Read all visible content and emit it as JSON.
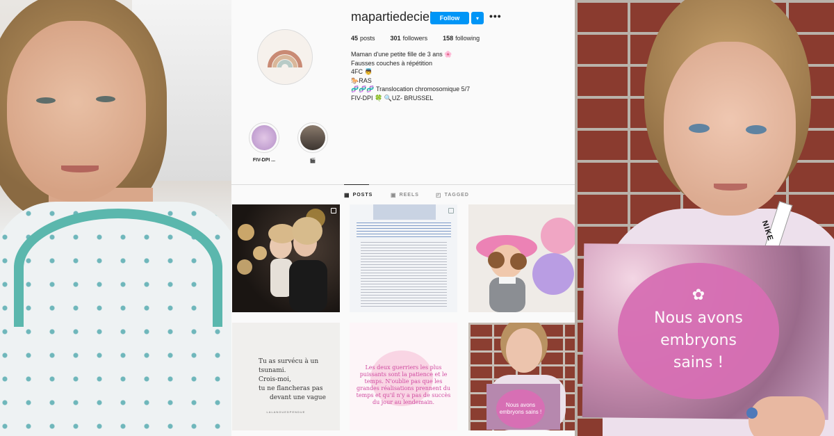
{
  "profile": {
    "username": "mapartiedeciel",
    "follow_label": "Follow",
    "dropdown_icon": "chevron-down-icon",
    "more_icon": "more-dots-icon",
    "stats": {
      "posts_count": "45",
      "posts_label": "posts",
      "followers_count": "301",
      "followers_label": "followers",
      "following_count": "158",
      "following_label": "following"
    },
    "bio": [
      "Maman d'une petite fille de 3 ans 🌸",
      "Fausses couches à répétition",
      "4FC 👼",
      "🐎RAS",
      "🧬🧬🧬 Translocation chromosomique 5/7",
      "FIV-DPI 🍀 🔍UZ- BRUSSEL"
    ]
  },
  "highlights": [
    {
      "label": "FIV-DPI ..."
    },
    {
      "label": "🎬"
    }
  ],
  "tabs": [
    {
      "label": "POSTS",
      "active": true
    },
    {
      "label": "REELS",
      "active": false
    },
    {
      "label": "TAGGED",
      "active": false
    }
  ],
  "posts": {
    "quote_lines": [
      "Tu as survécu à un tsunami.",
      "Crois-moi,",
      "tu ne flancheras pas",
      "devant une vague"
    ],
    "quote_signature": "LALANGUEDPENDUE",
    "quote2": "Les deux guerriers les plus puissants sont la patience et le temps. N'oublie pas que les grandes réalisations prennent du temps et qu'il n'y a pas de succès du jour au lendemain.",
    "mini_sign": "Nous avons embryons sains !"
  },
  "sign": {
    "line1": "Nous avons",
    "line2": "embryons",
    "line3": "sains !"
  },
  "strap_text": "NIKE",
  "colors": {
    "follow_blue": "#0095f6",
    "sign_pink": "#d76fb4",
    "gown_teal": "#5bb7ad"
  }
}
